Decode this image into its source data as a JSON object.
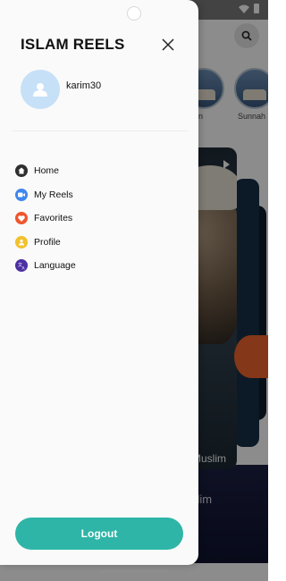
{
  "drawer": {
    "title": "ISLAM REELS",
    "username": "karim30",
    "menu": [
      {
        "label": "Home",
        "icon": "home-icon",
        "color": "#2f2f2f"
      },
      {
        "label": "My Reels",
        "icon": "video-icon",
        "color": "#3f86f0"
      },
      {
        "label": "Favorites",
        "icon": "heart-icon",
        "color": "#f0552c"
      },
      {
        "label": "Profile",
        "icon": "user-icon",
        "color": "#f2c12e"
      },
      {
        "label": "Language",
        "icon": "translate-icon",
        "color": "#4b2ea3"
      }
    ],
    "logout_label": "Logout",
    "accent": "#2eb5a7"
  },
  "background": {
    "categories": [
      "an",
      "Sunnah"
    ],
    "reel_caption": "Muslim",
    "reel_subtitle": "slim"
  }
}
